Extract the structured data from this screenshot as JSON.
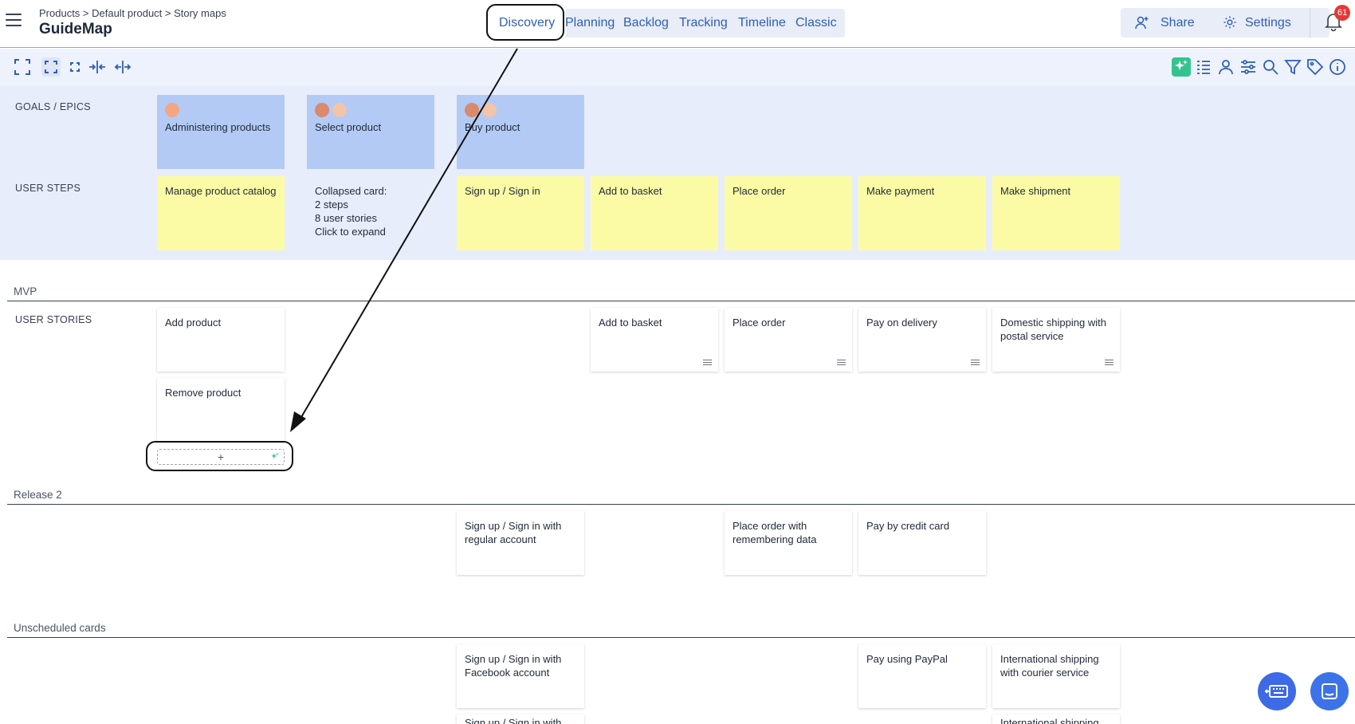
{
  "header": {
    "breadcrumb": "Products > Default product > Story maps",
    "title": "GuideMap",
    "tabs": [
      "Discovery",
      "Planning",
      "Backlog",
      "Tracking",
      "Timeline",
      "Classic"
    ],
    "share_label": "Share",
    "settings_label": "Settings",
    "notification_count": "61"
  },
  "rows": {
    "goals": "GOALS / EPICS",
    "steps": "USER STEPS",
    "stories": "USER STORIES"
  },
  "epics": [
    "Administering products",
    "Select product",
    "Buy product"
  ],
  "steps": [
    "Manage product catalog",
    "Sign up / Sign in",
    "Add to basket",
    "Place order",
    "Make payment",
    "Make shipment"
  ],
  "collapsed": {
    "line1": "Collapsed card:",
    "line2": "2 steps",
    "line3": "8 user stories",
    "line4": "Click to expand"
  },
  "releases": {
    "mvp": "MVP",
    "r2": "Release 2",
    "unscheduled": "Unscheduled cards"
  },
  "mvp_stories": {
    "add_product": "Add product",
    "remove_product": "Remove product",
    "add_to_basket": "Add to basket",
    "place_order": "Place order",
    "pay_on_delivery": "Pay on delivery",
    "domestic": "Domestic shipping with postal service"
  },
  "add_slot_label": "+",
  "r2_stories": {
    "signup_regular": "Sign up / Sign in with regular account",
    "place_order_remember": "Place order with remembering data",
    "pay_credit": "Pay by credit card"
  },
  "unscheduled_stories": {
    "signup_facebook": "Sign up / Sign in with Facebook account",
    "paypal": "Pay using PayPal",
    "international": "International shipping with courier service",
    "signup_partial": "Sign up / Sign in with",
    "international_partial": "International shipping"
  },
  "colors": {
    "epic": "#b3caf5",
    "step": "#fbfba6",
    "accent": "#2f5fb3",
    "ai": "#34c38f"
  }
}
